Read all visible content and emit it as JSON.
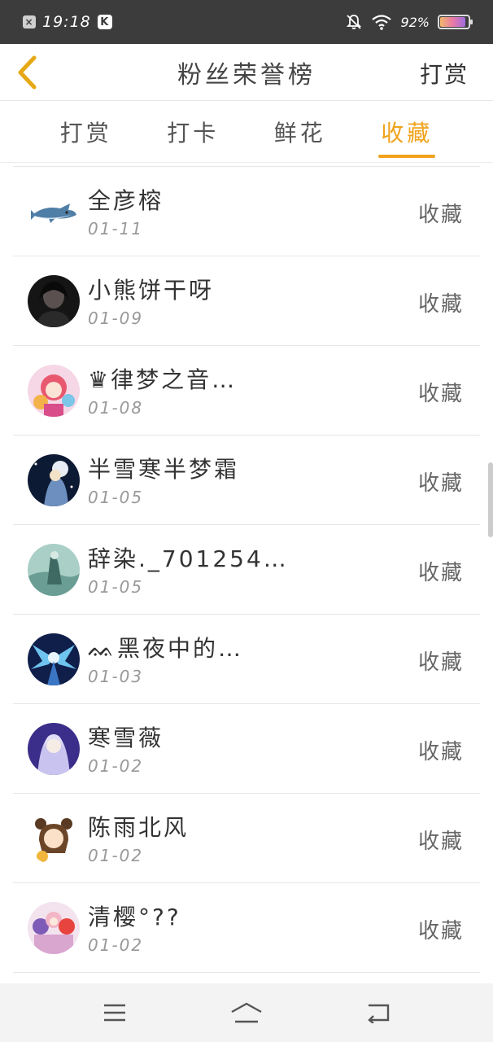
{
  "status_bar": {
    "time": "19:18",
    "left_badge": "K",
    "battery_percent_label": "92%",
    "battery_level": 0.92,
    "icons": [
      "close-notification-icon",
      "k-app-icon",
      "mute-bell-icon",
      "wifi-icon",
      "battery-icon"
    ]
  },
  "header": {
    "back_icon": "chevron-left-icon",
    "title": "粉丝荣誉榜",
    "action_label": "打赏"
  },
  "tabs": [
    {
      "label": "打赏",
      "active": false
    },
    {
      "label": "打卡",
      "active": false
    },
    {
      "label": "鲜花",
      "active": false
    },
    {
      "label": "收藏",
      "active": true
    }
  ],
  "accent_color": "#f0a21c",
  "list": [
    {
      "name": "全彦榕",
      "date": "01-11",
      "type": "收藏",
      "avatar": "shark-avatar"
    },
    {
      "name": "小熊饼干呀",
      "date": "01-09",
      "type": "收藏",
      "avatar": "dark-portrait-avatar"
    },
    {
      "name": "♛律梦之音…",
      "date": "01-08",
      "type": "收藏",
      "avatar": "anime-pink-avatar"
    },
    {
      "name": "半雪寒半梦霜",
      "date": "01-05",
      "type": "收藏",
      "avatar": "anime-night-avatar"
    },
    {
      "name": "辞染._701254…",
      "date": "01-05",
      "type": "收藏",
      "avatar": "teal-figure-avatar"
    },
    {
      "name": "ᨐ黑夜中的…",
      "date": "01-03",
      "type": "收藏",
      "avatar": "blue-angel-avatar"
    },
    {
      "name": "寒雪薇",
      "date": "01-02",
      "type": "收藏",
      "avatar": "purple-anime-avatar"
    },
    {
      "name": "陈雨北风",
      "date": "01-02",
      "type": "收藏",
      "avatar": "chibi-girl-avatar"
    },
    {
      "name": "清樱°??",
      "date": "01-02",
      "type": "收藏",
      "avatar": "anime-group-avatar"
    }
  ],
  "navbar": {
    "icons": [
      "menu-icon",
      "home-icon",
      "back-icon"
    ]
  }
}
